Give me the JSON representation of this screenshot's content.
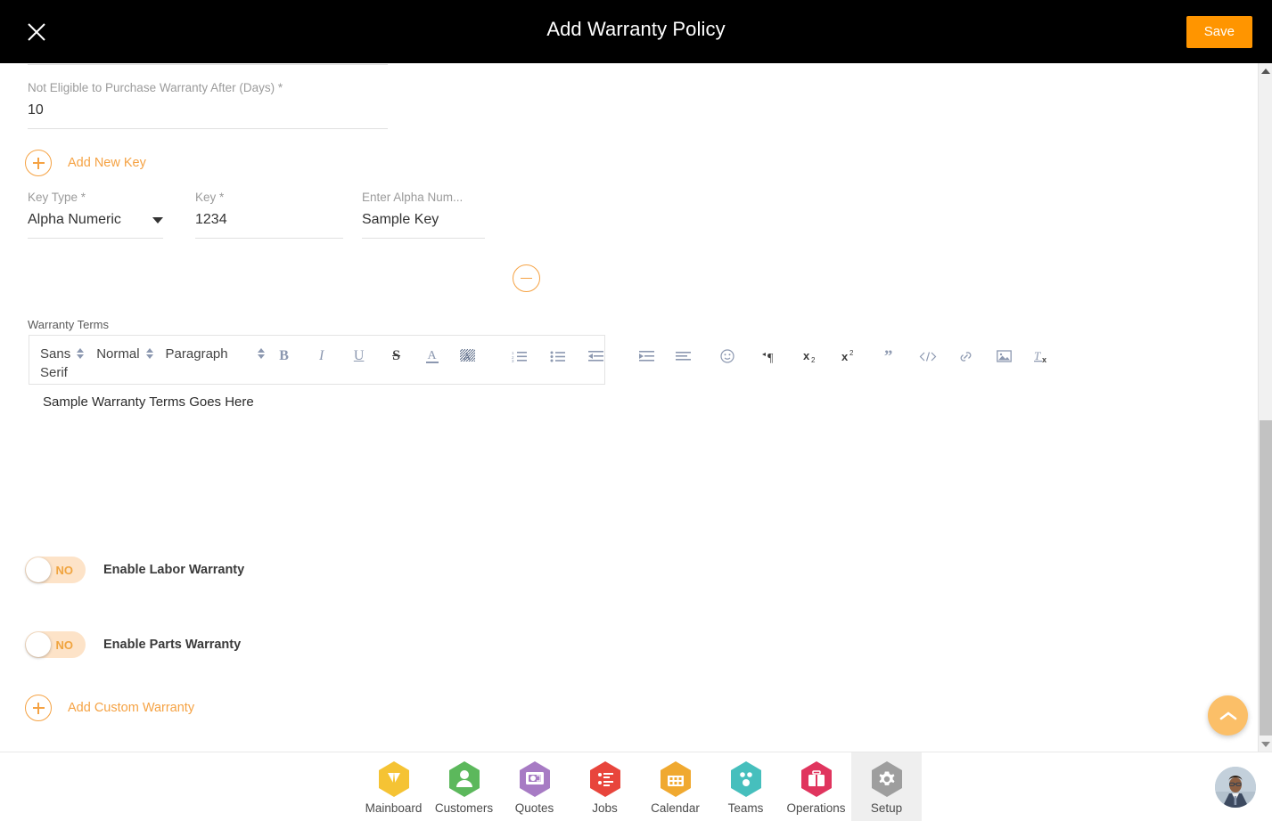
{
  "header": {
    "title": "Add Warranty Policy",
    "close_icon": "close-icon",
    "save_label": "Save"
  },
  "form": {
    "not_eligible_field": {
      "label": "Not Eligible to Purchase Warranty After (Days) *",
      "value": "10"
    },
    "add_new_key_label": "Add New Key",
    "key_row": {
      "key_type": {
        "label": "Key Type *",
        "value": "Alpha Numeric"
      },
      "key": {
        "label": "Key *",
        "value": "1234"
      },
      "alpha_num": {
        "label": "Enter Alpha Num...",
        "value": "Sample Key"
      },
      "remove_icon": "minus-circle-icon"
    },
    "warranty_terms": {
      "label": "Warranty Terms",
      "content": "Sample Warranty Terms Goes Here",
      "toolbar": {
        "font_family": "Sans Serif",
        "font_size": "Normal",
        "block_style": "Paragraph",
        "buttons": [
          {
            "name": "bold-icon",
            "glyph": "B"
          },
          {
            "name": "italic-icon",
            "glyph": "I"
          },
          {
            "name": "underline-icon",
            "glyph": "U"
          },
          {
            "name": "strikethrough-icon",
            "glyph": "S"
          },
          {
            "name": "text-color-icon",
            "glyph": "A"
          },
          {
            "name": "highlight-color-icon",
            "glyph": "A"
          },
          {
            "name": "ordered-list-icon",
            "glyph": ""
          },
          {
            "name": "bullet-list-icon",
            "glyph": ""
          },
          {
            "name": "outdent-icon",
            "glyph": ""
          },
          {
            "name": "indent-icon",
            "glyph": ""
          },
          {
            "name": "align-icon",
            "glyph": ""
          },
          {
            "name": "emoji-icon",
            "glyph": ""
          },
          {
            "name": "text-direction-icon",
            "glyph": ""
          },
          {
            "name": "subscript-icon",
            "glyph": "x"
          },
          {
            "name": "superscript-icon",
            "glyph": "x"
          },
          {
            "name": "blockquote-icon",
            "glyph": "”"
          },
          {
            "name": "code-block-icon",
            "glyph": ""
          },
          {
            "name": "link-icon",
            "glyph": ""
          },
          {
            "name": "image-icon",
            "glyph": ""
          },
          {
            "name": "clear-format-icon",
            "glyph": ""
          }
        ]
      }
    },
    "toggles": [
      {
        "name": "enable-labor-warranty",
        "state_text": "NO",
        "label": "Enable Labor Warranty",
        "on": false
      },
      {
        "name": "enable-parts-warranty",
        "state_text": "NO",
        "label": "Enable Parts Warranty",
        "on": false
      }
    ],
    "add_custom_warranty_label": "Add Custom Warranty"
  },
  "scroll_to_top": {
    "icon": "chevron-up-icon"
  },
  "scrollbar": {
    "up_icon": "scroll-up-arrow",
    "down_icon": "scroll-down-arrow"
  },
  "bottom_nav": {
    "items": [
      {
        "label": "Mainboard",
        "icon": "mainboard-icon",
        "color": "#f5c334",
        "active": false
      },
      {
        "label": "Customers",
        "icon": "customers-icon",
        "color": "#5cb85c",
        "active": false
      },
      {
        "label": "Quotes",
        "icon": "quotes-icon",
        "color": "#a77bc4",
        "active": false
      },
      {
        "label": "Jobs",
        "icon": "jobs-icon",
        "color": "#e8453c",
        "active": false
      },
      {
        "label": "Calendar",
        "icon": "calendar-icon",
        "color": "#f0a930",
        "active": false
      },
      {
        "label": "Teams",
        "icon": "teams-icon",
        "color": "#46bfbd",
        "active": false
      },
      {
        "label": "Operations",
        "icon": "operations-icon",
        "color": "#e0355e",
        "active": false
      },
      {
        "label": "Setup",
        "icon": "setup-gear-icon",
        "color": "#9e9e9e",
        "active": true
      }
    ],
    "avatar": "user-avatar"
  },
  "colors": {
    "accent_orange": "#ff9500",
    "link_orange": "#f5a243",
    "header_bg": "#000000"
  }
}
